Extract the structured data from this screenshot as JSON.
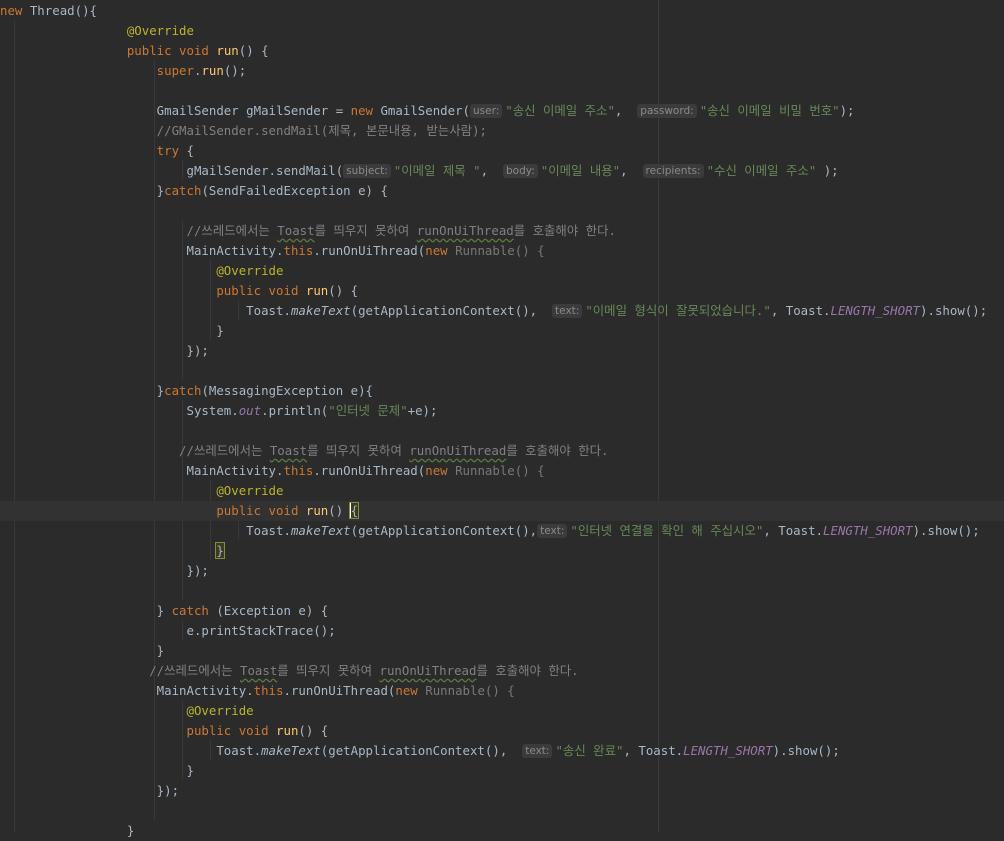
{
  "editor": {
    "lines": [
      {
        "tokens": [
          {
            "t": "new",
            "c": "kw"
          },
          {
            "t": " Thread(){"
          }
        ]
      },
      {
        "tokens": [
          {
            "t": "                 "
          },
          {
            "t": "@Override",
            "c": "ann"
          }
        ]
      },
      {
        "tokens": [
          {
            "t": "                 "
          },
          {
            "t": "public void",
            "c": "kw"
          },
          {
            "t": " "
          },
          {
            "t": "run",
            "c": "fn"
          },
          {
            "t": "() {"
          }
        ]
      },
      {
        "tokens": [
          {
            "t": "                     "
          },
          {
            "t": "super",
            "c": "kw"
          },
          {
            "t": "."
          },
          {
            "t": "run",
            "c": "fn"
          },
          {
            "t": "();"
          }
        ]
      },
      {
        "tokens": []
      },
      {
        "tokens": [
          {
            "t": "                     GmailSender gMailSender = "
          },
          {
            "t": "new",
            "c": "kw"
          },
          {
            "t": " GmailSender("
          },
          {
            "h": "user:"
          },
          {
            "t": "\"송신 이메일 주소\"",
            "c": "str"
          },
          {
            "t": ",  "
          },
          {
            "h": "password:"
          },
          {
            "t": "\"송신 이메일 비밀 번호\"",
            "c": "str"
          },
          {
            "t": ");"
          }
        ]
      },
      {
        "tokens": [
          {
            "t": "                     "
          },
          {
            "t": "//GMailSender.sendMail(제목, 본문내용, 받는사람);",
            "c": "cm"
          }
        ]
      },
      {
        "tokens": [
          {
            "t": "                     "
          },
          {
            "t": "try",
            "c": "kw"
          },
          {
            "t": " {"
          }
        ]
      },
      {
        "tokens": [
          {
            "t": "                         gMailSender.sendMail("
          },
          {
            "h": "subject:"
          },
          {
            "t": "\"이메일 제목 \"",
            "c": "str"
          },
          {
            "t": ",  "
          },
          {
            "h": "body:"
          },
          {
            "t": "\"이메일 내용\"",
            "c": "str"
          },
          {
            "t": ",  "
          },
          {
            "h": "recipients:"
          },
          {
            "t": "\"수신 이메일 주소\"",
            "c": "str"
          },
          {
            "t": " );"
          }
        ]
      },
      {
        "tokens": [
          {
            "t": "                     }"
          },
          {
            "t": "catch",
            "c": "kw"
          },
          {
            "t": "(SendFailedException e) {"
          }
        ]
      },
      {
        "tokens": []
      },
      {
        "tokens": [
          {
            "t": "                         "
          },
          {
            "t": "//쓰레드에서는 ",
            "c": "cm"
          },
          {
            "t": "Toast",
            "c": "cm wavy"
          },
          {
            "t": "를 띄우지 못하여 ",
            "c": "cm"
          },
          {
            "t": "runOnUiThread",
            "c": "cm wavy"
          },
          {
            "t": "를 호출해야 한다.",
            "c": "cm"
          }
        ]
      },
      {
        "tokens": [
          {
            "t": "                         MainActivity."
          },
          {
            "t": "this",
            "c": "kw"
          },
          {
            "t": ".runOnUiThread("
          },
          {
            "t": "new",
            "c": "kw"
          },
          {
            "t": " Runnable() {",
            "c": "dim"
          }
        ]
      },
      {
        "tokens": [
          {
            "t": "                             "
          },
          {
            "t": "@Override",
            "c": "ann"
          }
        ]
      },
      {
        "tokens": [
          {
            "t": "                             "
          },
          {
            "t": "public void",
            "c": "kw"
          },
          {
            "t": " "
          },
          {
            "t": "run",
            "c": "fn"
          },
          {
            "t": "() {"
          }
        ]
      },
      {
        "tokens": [
          {
            "t": "                                 Toast."
          },
          {
            "t": "makeText",
            "c": "it"
          },
          {
            "t": "(getApplicationContext(),  "
          },
          {
            "h": "text:"
          },
          {
            "t": "\"이메일 형식이 잘못되었습니다.\"",
            "c": "str"
          },
          {
            "t": ", Toast."
          },
          {
            "t": "LENGTH_SHORT",
            "c": "const"
          },
          {
            "t": ").show();"
          }
        ]
      },
      {
        "tokens": [
          {
            "t": "                             }"
          }
        ]
      },
      {
        "tokens": [
          {
            "t": "                         });"
          }
        ]
      },
      {
        "tokens": []
      },
      {
        "tokens": [
          {
            "t": "                     }"
          },
          {
            "t": "catch",
            "c": "kw"
          },
          {
            "t": "(MessagingException e){"
          }
        ]
      },
      {
        "tokens": [
          {
            "t": "                         System."
          },
          {
            "t": "out",
            "c": "const"
          },
          {
            "t": ".println("
          },
          {
            "t": "\"인터넷 문제\"",
            "c": "str"
          },
          {
            "t": "+e);"
          }
        ]
      },
      {
        "tokens": []
      },
      {
        "tokens": [
          {
            "t": "                        "
          },
          {
            "t": "//쓰레드에서는 ",
            "c": "cm"
          },
          {
            "t": "Toast",
            "c": "cm wavy"
          },
          {
            "t": "를 띄우지 못하여 ",
            "c": "cm"
          },
          {
            "t": "runOnUiThread",
            "c": "cm wavy"
          },
          {
            "t": "를 호출해야 한다.",
            "c": "cm"
          }
        ]
      },
      {
        "tokens": [
          {
            "t": "                         MainActivity."
          },
          {
            "t": "this",
            "c": "kw"
          },
          {
            "t": ".runOnUiThread("
          },
          {
            "t": "new",
            "c": "kw"
          },
          {
            "t": " Runnable() {",
            "c": "dim"
          }
        ]
      },
      {
        "tokens": [
          {
            "t": "                             "
          },
          {
            "t": "@Override",
            "c": "ann"
          }
        ]
      },
      {
        "tokens": [
          {
            "t": "                             "
          },
          {
            "t": "public void",
            "c": "kw"
          },
          {
            "t": " "
          },
          {
            "t": "run",
            "c": "fn"
          },
          {
            "t": "() "
          },
          {
            "t": "{",
            "c": "hl-brace caret"
          }
        ],
        "current": true
      },
      {
        "tokens": [
          {
            "t": "                                 Toast."
          },
          {
            "t": "makeText",
            "c": "it"
          },
          {
            "t": "(getApplicationContext(),"
          },
          {
            "h": "text:"
          },
          {
            "t": "\"인터넷 연결을 확인 해 주십시오\"",
            "c": "str"
          },
          {
            "t": ", Toast."
          },
          {
            "t": "LENGTH_SHORT",
            "c": "const"
          },
          {
            "t": ").show();"
          }
        ]
      },
      {
        "tokens": [
          {
            "t": "                             "
          },
          {
            "t": "}",
            "c": "hl-brace"
          }
        ]
      },
      {
        "tokens": [
          {
            "t": "                         });"
          }
        ]
      },
      {
        "tokens": []
      },
      {
        "tokens": [
          {
            "t": "                     } "
          },
          {
            "t": "catch",
            "c": "kw"
          },
          {
            "t": " (Exception e) {"
          }
        ]
      },
      {
        "tokens": [
          {
            "t": "                         e.printStackTrace();"
          }
        ]
      },
      {
        "tokens": [
          {
            "t": "                     }"
          }
        ]
      },
      {
        "tokens": [
          {
            "t": "                    "
          },
          {
            "t": "//쓰레드에서는 ",
            "c": "cm"
          },
          {
            "t": "Toast",
            "c": "cm wavy"
          },
          {
            "t": "를 띄우지 못하여 ",
            "c": "cm"
          },
          {
            "t": "runOnUiThread",
            "c": "cm wavy"
          },
          {
            "t": "를 호출해야 한다.",
            "c": "cm"
          }
        ]
      },
      {
        "tokens": [
          {
            "t": "                     MainActivity."
          },
          {
            "t": "this",
            "c": "kw"
          },
          {
            "t": ".runOnUiThread("
          },
          {
            "t": "new",
            "c": "kw"
          },
          {
            "t": " Runnable() {",
            "c": "dim"
          }
        ]
      },
      {
        "tokens": [
          {
            "t": "                         "
          },
          {
            "t": "@Override",
            "c": "ann"
          }
        ]
      },
      {
        "tokens": [
          {
            "t": "                         "
          },
          {
            "t": "public void",
            "c": "kw"
          },
          {
            "t": " "
          },
          {
            "t": "run",
            "c": "fn"
          },
          {
            "t": "() {"
          }
        ]
      },
      {
        "tokens": [
          {
            "t": "                             Toast."
          },
          {
            "t": "makeText",
            "c": "it"
          },
          {
            "t": "(getApplicationContext(),  "
          },
          {
            "h": "text:"
          },
          {
            "t": "\"송신 완료\"",
            "c": "str"
          },
          {
            "t": ", Toast."
          },
          {
            "t": "LENGTH_SHORT",
            "c": "const"
          },
          {
            "t": ").show();"
          }
        ]
      },
      {
        "tokens": [
          {
            "t": "                         }"
          }
        ]
      },
      {
        "tokens": [
          {
            "t": "                     });"
          }
        ]
      },
      {
        "tokens": []
      },
      {
        "tokens": [
          {
            "t": "                 }"
          }
        ]
      }
    ]
  }
}
